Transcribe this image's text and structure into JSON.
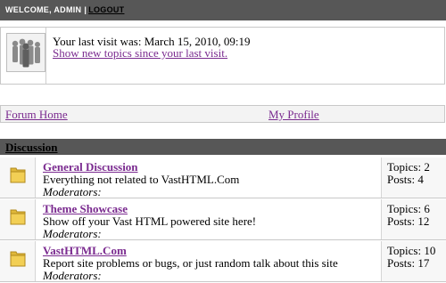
{
  "header": {
    "welcome": "WELCOME, ADMIN",
    "separator": "|",
    "logout": "LOGOUT"
  },
  "visit": {
    "last_visit": "Your last visit was: March 15, 2010, 09:19",
    "new_topics_link": "Show new topics since your last visit."
  },
  "nav": {
    "home": "Forum Home",
    "profile": "My Profile"
  },
  "category": {
    "title": "Discussion"
  },
  "forums": [
    {
      "name": "General Discussion",
      "description": "Everything not related to VastHTML.Com",
      "moderators": "Moderators:",
      "topics": "Topics: 2",
      "posts": "Posts: 4"
    },
    {
      "name": "Theme Showcase",
      "description": "Show off your Vast HTML powered site here!",
      "moderators": "Moderators:",
      "topics": "Topics: 6",
      "posts": "Posts: 12"
    },
    {
      "name": "VastHTML.Com",
      "description": "Report site problems or bugs, or just random talk about this site",
      "moderators": "Moderators:",
      "topics": "Topics: 10",
      "posts": "Posts: 17"
    }
  ],
  "icons": {
    "avatar": "users-group-icon",
    "forum": "folder-icon"
  }
}
